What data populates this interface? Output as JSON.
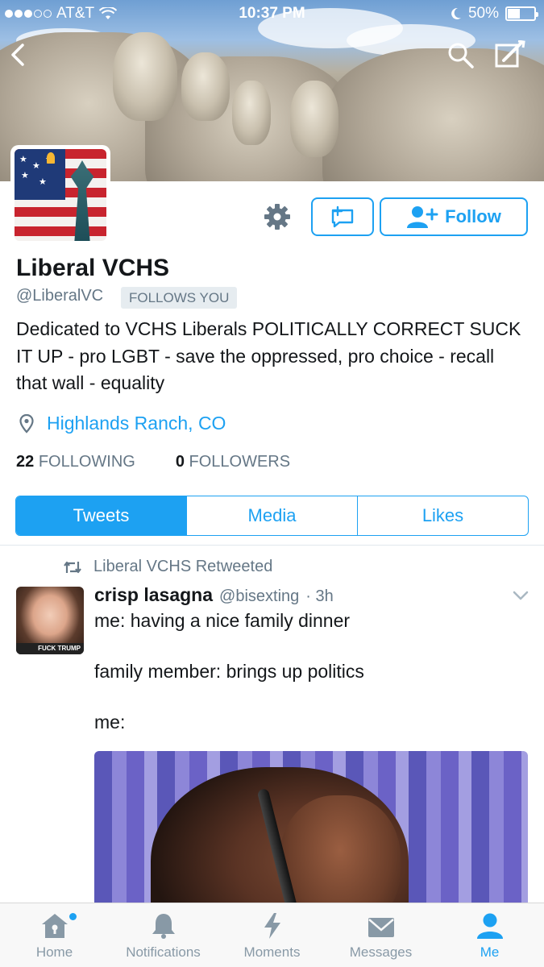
{
  "status_bar": {
    "carrier": "AT&T",
    "time": "10:37 PM",
    "battery": "50%",
    "battery_level": 0.5
  },
  "header": {
    "back_icon": "chevron-left-icon",
    "search_icon": "search-icon",
    "compose_icon": "compose-icon"
  },
  "profile": {
    "name": "Liberal VCHS",
    "handle": "@LiberalVC",
    "follows_you": "FOLLOWS YOU",
    "follow_label": "Follow",
    "bio": "Dedicated to VCHS Liberals POLITICALLY CORRECT SUCK IT UP - pro LGBT - save the oppressed, pro choice - recall that wall - equality",
    "location": "Highlands Ranch, CO",
    "following_count": "22",
    "following_label": "FOLLOWING",
    "followers_count": "0",
    "followers_label": "FOLLOWERS"
  },
  "tabs": [
    {
      "label": "Tweets",
      "active": true
    },
    {
      "label": "Media",
      "active": false
    },
    {
      "label": "Likes",
      "active": false
    }
  ],
  "tweet": {
    "retweet_text": "Liberal VCHS Retweeted",
    "author_name": "crisp lasagna",
    "author_handle": "@bisexting",
    "time": "· 3h",
    "text": "me: having a nice family dinner\n\nfamily member: brings up politics\n\nme:",
    "avatar_overlay_text": "FUCK TRUMP"
  },
  "tab_bar": [
    {
      "label": "Home",
      "icon": "home-icon",
      "active": false,
      "has_dot": true
    },
    {
      "label": "Notifications",
      "icon": "bell-icon",
      "active": false
    },
    {
      "label": "Moments",
      "icon": "lightning-icon",
      "active": false
    },
    {
      "label": "Messages",
      "icon": "envelope-icon",
      "active": false
    },
    {
      "label": "Me",
      "icon": "person-icon",
      "active": true
    }
  ],
  "colors": {
    "accent": "#1da1f2",
    "secondary_text": "#657786",
    "primary_text": "#14171a"
  }
}
